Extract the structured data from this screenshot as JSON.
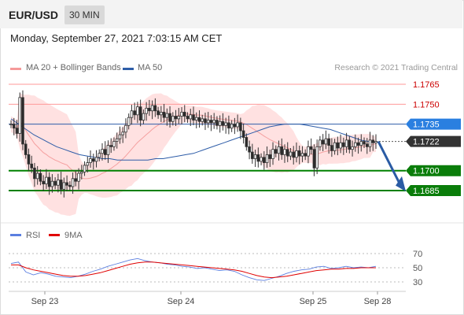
{
  "header": {
    "symbol": "EUR/USD",
    "timeframe": "30 MIN"
  },
  "datetime": "Monday, September 27, 2021 7:03:15 AM CET",
  "legend": {
    "ma20_label": "MA 20 + Bollinger Bands",
    "ma50_label": "MA 50",
    "credit": "Research © 2021 Trading Central"
  },
  "colors": {
    "resistance": "#ff9a9a",
    "resistance_text": "#cc0000",
    "support": "#008000",
    "ma50": "#2e5da8",
    "bollinger_fill": "#ffdcdc",
    "candle_up": "#2a2a2a",
    "candle_down": "#2a2a2a",
    "rsi": "#5b7fe0",
    "rsi_ma": "#e00000",
    "forecast_arrow": "#2a5ba4"
  },
  "chart_data": [
    {
      "type": "candlestick",
      "x_ticks": [
        "Sep 23",
        "Sep 24",
        "Sep 25",
        "Sep 28"
      ],
      "ylim": [
        1.1672,
        1.1772
      ],
      "levels": [
        {
          "value": 1.1765,
          "label": "1.1765",
          "kind": "resistance"
        },
        {
          "value": 1.175,
          "label": "1.1750",
          "kind": "resistance"
        },
        {
          "value": 1.1735,
          "label": "1.1735",
          "kind": "ma50"
        },
        {
          "value": 1.1722,
          "label": "1.1722",
          "kind": "last"
        },
        {
          "value": 1.17,
          "label": "1.1700",
          "kind": "support"
        },
        {
          "value": 1.1685,
          "label": "1.1685",
          "kind": "support"
        }
      ],
      "candles_close": [
        1.1735,
        1.1732,
        1.1728,
        1.1755,
        1.172,
        1.1712,
        1.1705,
        1.1702,
        1.1694,
        1.1698,
        1.1692,
        1.169,
        1.1695,
        1.1688,
        1.1692,
        1.1689,
        1.1693,
        1.1686,
        1.1691,
        1.1689,
        1.1688,
        1.1694,
        1.1692,
        1.1698,
        1.1699,
        1.1704,
        1.1706,
        1.1709,
        1.1707,
        1.171,
        1.1713,
        1.1716,
        1.1712,
        1.1719,
        1.1718,
        1.1722,
        1.1724,
        1.1727,
        1.1729,
        1.1734,
        1.174,
        1.1745,
        1.1742,
        1.1748,
        1.1738,
        1.1743,
        1.1747,
        1.1745,
        1.1749,
        1.1745,
        1.1742,
        1.1744,
        1.174,
        1.1743,
        1.1737,
        1.1741,
        1.1739,
        1.1741,
        1.1744,
        1.1741,
        1.1739,
        1.1742,
        1.1738,
        1.174,
        1.1737,
        1.1739,
        1.1736,
        1.1738,
        1.1736,
        1.1738,
        1.1734,
        1.1737,
        1.1734,
        1.1736,
        1.1732,
        1.1735,
        1.1733,
        1.1736,
        1.173,
        1.1725,
        1.1718,
        1.1714,
        1.1709,
        1.1712,
        1.1707,
        1.171,
        1.1706,
        1.1712,
        1.1709,
        1.1716,
        1.1713,
        1.1718,
        1.1712,
        1.1716,
        1.1711,
        1.1714,
        1.171,
        1.1715,
        1.1711,
        1.1713,
        1.1711,
        1.1718,
        1.1716,
        1.1702,
        1.1718,
        1.1723,
        1.172,
        1.1724,
        1.1719,
        1.1715,
        1.1721,
        1.1717,
        1.1721,
        1.1718,
        1.1723,
        1.1716,
        1.1718,
        1.1721,
        1.1719,
        1.1722,
        1.172,
        1.1718,
        1.1723,
        1.1721,
        1.1722
      ],
      "ma50": [
        1.1739,
        1.1735,
        1.1731,
        1.1727,
        1.1724,
        1.1721,
        1.1718,
        1.1716,
        1.1714,
        1.1712,
        1.1711,
        1.171,
        1.1709,
        1.1709,
        1.1708,
        1.1708,
        1.1708,
        1.1708,
        1.1708,
        1.1709,
        1.1709,
        1.171,
        1.1711,
        1.1712,
        1.1713,
        1.1715,
        1.1717,
        1.1719,
        1.1721,
        1.1723,
        1.1725,
        1.1727,
        1.1729,
        1.1731,
        1.1733,
        1.1734,
        1.1735,
        1.1735,
        1.1735,
        1.1734,
        1.1733,
        1.1732,
        1.1731,
        1.1729,
        1.1727,
        1.1725,
        1.1723,
        1.1722,
        1.1721
      ],
      "rsi": {
        "levels": [
          70,
          50,
          30
        ],
        "rsi_values": [
          56,
          58,
          44,
          40,
          43,
          41,
          38,
          37,
          36,
          38,
          41,
          45,
          48,
          52,
          55,
          58,
          61,
          63,
          60,
          58,
          57,
          55,
          54,
          52,
          51,
          49,
          50,
          48,
          46,
          47,
          45,
          40,
          36,
          33,
          32,
          35,
          38,
          42,
          45,
          47,
          48,
          51,
          52,
          49,
          50,
          52,
          50,
          51,
          50,
          52
        ],
        "ma_values": [
          54,
          54,
          50,
          47,
          45,
          43,
          41,
          39,
          38,
          38,
          39,
          41,
          43,
          46,
          49,
          52,
          55,
          57,
          58,
          58,
          57,
          56,
          55,
          54,
          53,
          52,
          51,
          50,
          49,
          48,
          47,
          45,
          42,
          39,
          37,
          36,
          37,
          38,
          40,
          42,
          44,
          46,
          47,
          48,
          48,
          49,
          49,
          50,
          50,
          50
        ],
        "legend": [
          "RSI",
          "9MA"
        ],
        "tick_labels": [
          "70",
          "50",
          "30"
        ]
      }
    }
  ]
}
